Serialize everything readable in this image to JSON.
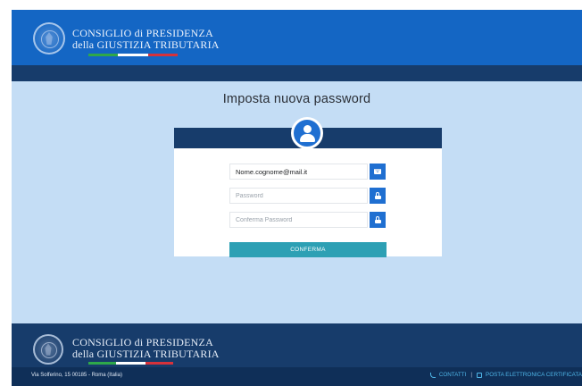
{
  "header": {
    "org_line1": "CONSIGLIO di PRESIDENZA",
    "org_line2": "della GIUSTIZIA TRIBUTARIA"
  },
  "main": {
    "title": "Imposta nuova password",
    "form": {
      "email_value": "Nome.cognome@mail.it",
      "password_placeholder": "Password",
      "confirm_placeholder": "Conferma Password",
      "confirm_button": "CONFERMA"
    }
  },
  "footer": {
    "org_line1": "CONSIGLIO di PRESIDENZA",
    "org_line2": "della GIUSTIZIA TRIBUTARIA",
    "address": "Via Solferino, 15 00185 - Roma (Italia)",
    "links": {
      "contacts": "CONTATTI",
      "separator": "|",
      "pec": "POSTA ELETTRONICA CERTIFICATA"
    }
  },
  "icons": {
    "email": "envelope-icon",
    "password": "lock-icon",
    "avatar": "user-icon",
    "contacts": "phone-icon",
    "pec": "pec-icon"
  },
  "colors": {
    "header_blue": "#1466c4",
    "dark_navy": "#173c6b",
    "page_background": "#c4ddf5",
    "action_blue": "#1f6fd1",
    "confirm_teal": "#2da0b4",
    "link_cyan": "#4fb6e8"
  }
}
